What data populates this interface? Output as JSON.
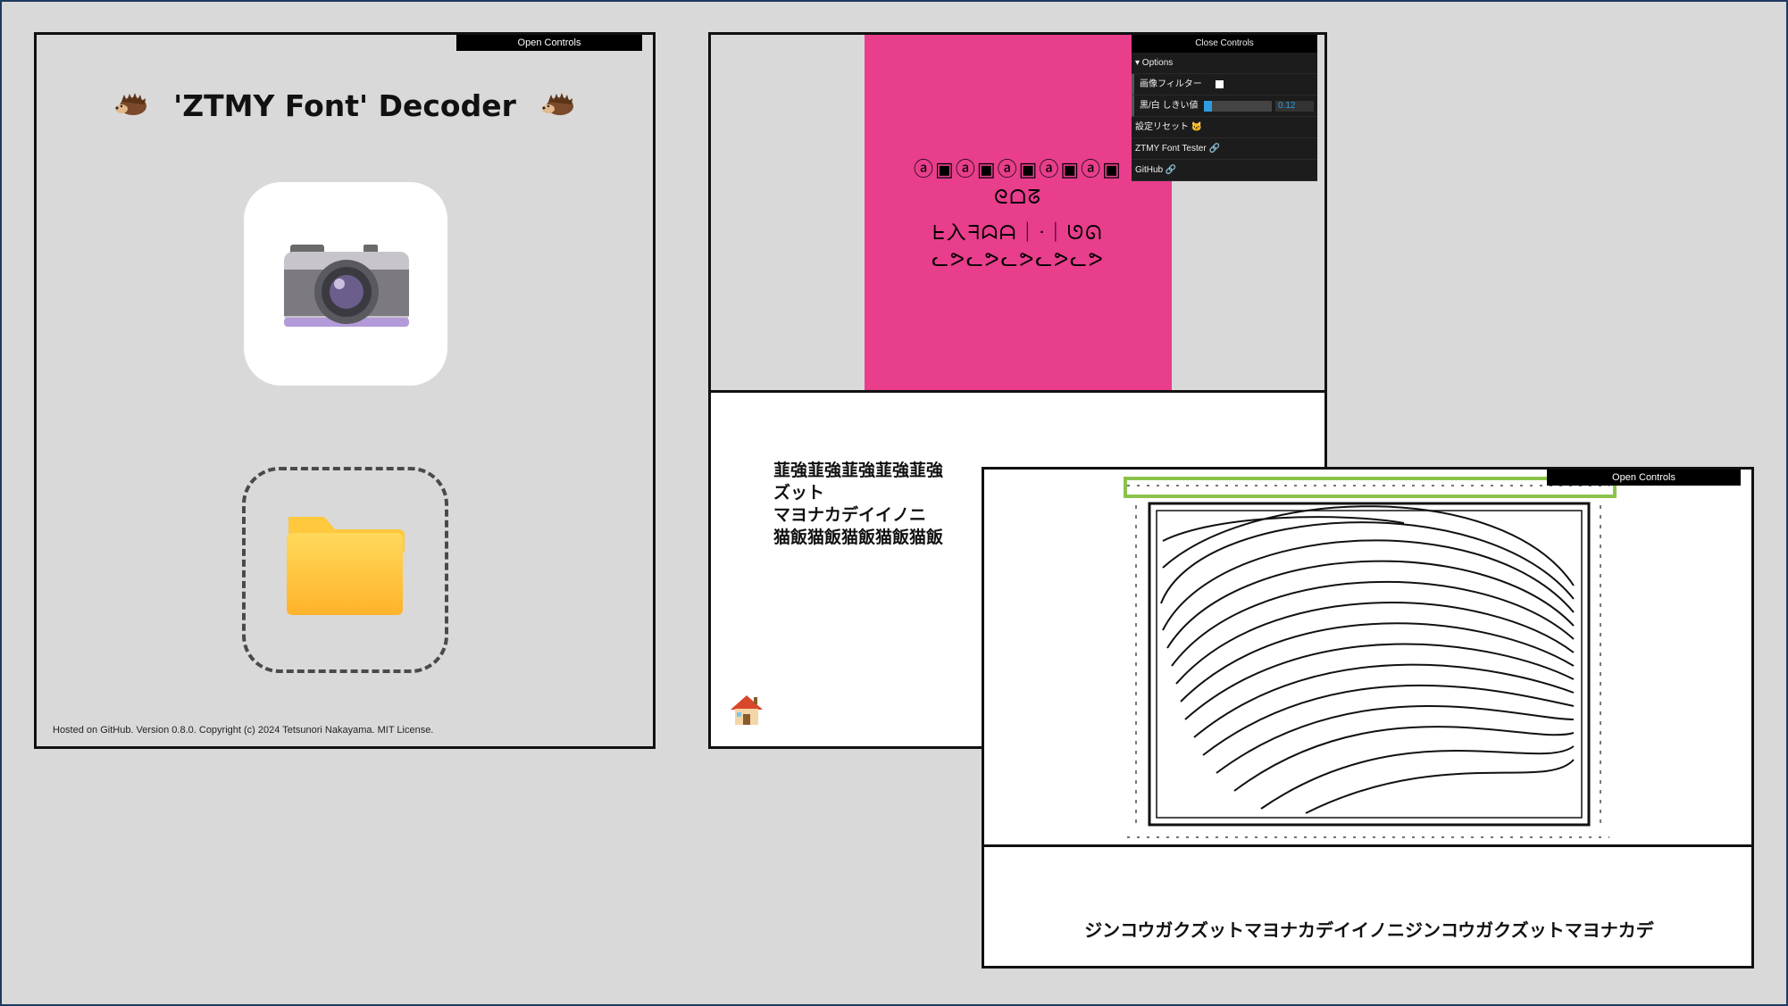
{
  "decoder_panel": {
    "open_controls_label": "Open Controls",
    "title": "'ZTMY Font' Decoder",
    "footer": "Hosted on GitHub. Version 0.8.0. Copyright (c) 2024 Tetsunori Nakayama. MIT License."
  },
  "preview_panel": {
    "close_controls_label": "Close Controls",
    "options_label": "▾ Options",
    "image_filter_label": "画像フィルター",
    "threshold_label": "黒/白 しきい値",
    "threshold_value": "0.12",
    "reset_label": "設定リセット",
    "font_tester_label": "ZTMY Font Tester",
    "github_label": "GitHub",
    "decoded_lines": [
      "韮強韮強韮強韮強韮強",
      "ズット",
      "マヨナカデイイノニ",
      "猫飯猫飯猫飯猫飯猫飯"
    ]
  },
  "scan_panel": {
    "open_controls_label": "Open Controls",
    "decoded_text": "ジンコウガクズットマヨナカデイイノニジンコウガクズットマヨナカデ"
  },
  "colors": {
    "background": "#d9d9d9",
    "pink_card": "#e83e8c",
    "slider_accent": "#2f9be0",
    "highlight_box": "#8bc34a"
  }
}
